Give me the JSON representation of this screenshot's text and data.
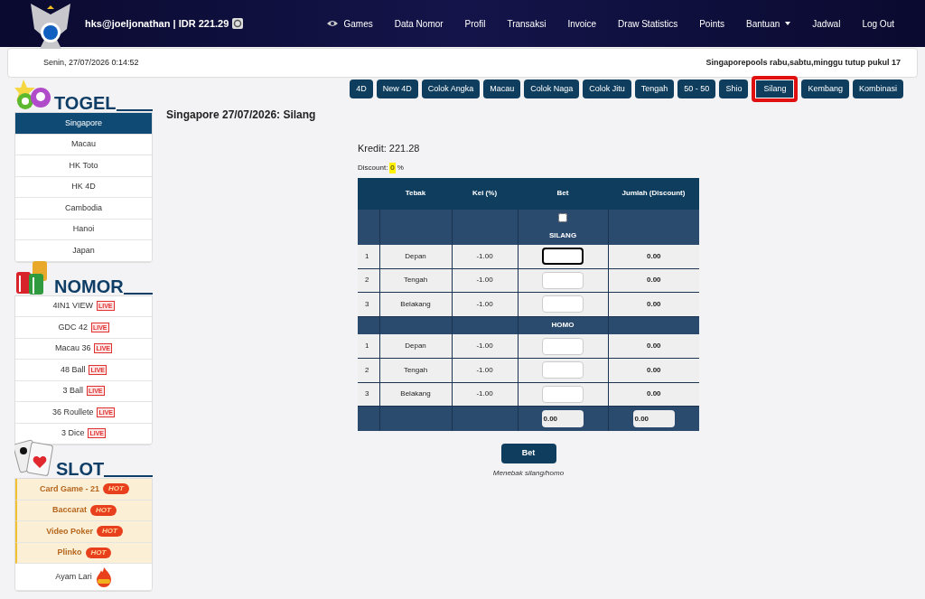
{
  "header": {
    "account": "hks@joeljonathan | IDR 221.29",
    "nav": [
      {
        "label": "Games",
        "kind": "eye",
        "dropdown": false
      },
      {
        "label": "Data Nomor",
        "dropdown": false
      },
      {
        "label": "Profil",
        "dropdown": false
      },
      {
        "label": "Transaksi",
        "dropdown": false
      },
      {
        "label": "Invoice",
        "dropdown": false
      },
      {
        "label": "Draw Statistics",
        "dropdown": false
      },
      {
        "label": "Points",
        "dropdown": false
      },
      {
        "label": "Bantuan",
        "dropdown": true
      },
      {
        "label": "Jadwal",
        "dropdown": false
      },
      {
        "label": "Log Out",
        "dropdown": false
      }
    ]
  },
  "info_bar": {
    "datetime": "Senin, 27/07/2026 0:14:52",
    "marquee": "Singaporepools rabu,sabtu,minggu tutup pukul 17"
  },
  "sidebar": [
    {
      "title": "TOGEL",
      "kind": "balls",
      "items": [
        {
          "label": "Singapore",
          "selected": true
        },
        {
          "label": "Macau",
          "selected": false
        },
        {
          "label": "HK Toto",
          "selected": false
        },
        {
          "label": "HK 4D",
          "selected": false
        },
        {
          "label": "Cambodia",
          "selected": false
        },
        {
          "label": "Hanoi",
          "selected": false
        },
        {
          "label": "Japan",
          "selected": false
        }
      ]
    },
    {
      "title": "NOMOR",
      "kind": "chips",
      "items": [
        {
          "label": "4IN1 VIEW",
          "badge": "LIVE",
          "kind": "live",
          "selected": false
        },
        {
          "label": "GDC 42",
          "badge": "LIVE",
          "kind": "live",
          "selected": false
        },
        {
          "label": "Macau 36",
          "badge": "LIVE",
          "kind": "live",
          "selected": false
        },
        {
          "label": "48 Ball",
          "badge": "LIVE",
          "kind": "live",
          "selected": false
        },
        {
          "label": "3 Ball",
          "badge": "LIVE",
          "kind": "live",
          "selected": false
        },
        {
          "label": "36 Roullete",
          "badge": "LIVE",
          "kind": "live",
          "selected": false
        },
        {
          "label": "3 Dice",
          "badge": "LIVE",
          "kind": "live",
          "selected": false
        }
      ]
    },
    {
      "title": "SLOT",
      "kind": "cards",
      "items": [
        {
          "label": "Card Game - 21",
          "badge": "HOT",
          "kind": "hot",
          "selected": false
        },
        {
          "label": "Baccarat",
          "badge": "HOT",
          "kind": "hot",
          "selected": false
        },
        {
          "label": "Video Poker",
          "badge": "HOT",
          "kind": "hot",
          "selected": false
        },
        {
          "label": "Plinko",
          "badge": "HOT",
          "kind": "hot",
          "selected": false
        },
        {
          "label": "Ayam Lari",
          "kind": "flame",
          "selected": false
        }
      ]
    }
  ],
  "tabs": [
    {
      "label": "4D",
      "selected": false
    },
    {
      "label": "New 4D",
      "selected": false
    },
    {
      "label": "Colok Angka",
      "selected": false
    },
    {
      "label": "Macau",
      "selected": false
    },
    {
      "label": "Colok Naga",
      "selected": false
    },
    {
      "label": "Colok Jitu",
      "selected": false
    },
    {
      "label": "Tengah",
      "selected": false
    },
    {
      "label": "50 - 50",
      "selected": false
    },
    {
      "label": "Shio",
      "selected": false
    },
    {
      "label": "Silang",
      "selected": true
    },
    {
      "label": "Kembang",
      "selected": false
    },
    {
      "label": "Kombinasi",
      "selected": false
    }
  ],
  "title": "Singapore 27/07/2026: Silang",
  "kredit": "Kredit: 221.28",
  "discount": {
    "label": "Discount:",
    "value": "0",
    "unit": "%"
  },
  "table": {
    "columns": [
      "Tebak",
      "Kei (%)",
      "Bet",
      "Jumlah (Discount)"
    ],
    "select_all": {
      "checked": false
    },
    "sections": [
      {
        "name": "SILANG",
        "rows": [
          {
            "no": "1",
            "tebak": "Depan",
            "kei": "-1.00",
            "focused": true,
            "jumlah": "0.00"
          },
          {
            "no": "2",
            "tebak": "Tengah",
            "kei": "-1.00",
            "focused": false,
            "jumlah": "0.00"
          },
          {
            "no": "3",
            "tebak": "Belakang",
            "kei": "-1.00",
            "focused": false,
            "jumlah": "0.00"
          }
        ]
      },
      {
        "name": "HOMO",
        "rows": [
          {
            "no": "1",
            "tebak": "Depan",
            "kei": "-1.00",
            "focused": false,
            "jumlah": "0.00"
          },
          {
            "no": "2",
            "tebak": "Tengah",
            "kei": "-1.00",
            "focused": false,
            "jumlah": "0.00"
          },
          {
            "no": "3",
            "tebak": "Belakang",
            "kei": "-1.00",
            "focused": false,
            "jumlah": "0.00"
          }
        ]
      }
    ],
    "totals": {
      "bet": "0.00",
      "jumlah": "0.00"
    }
  },
  "submit": "Bet",
  "note": "Menebak silang/homo"
}
